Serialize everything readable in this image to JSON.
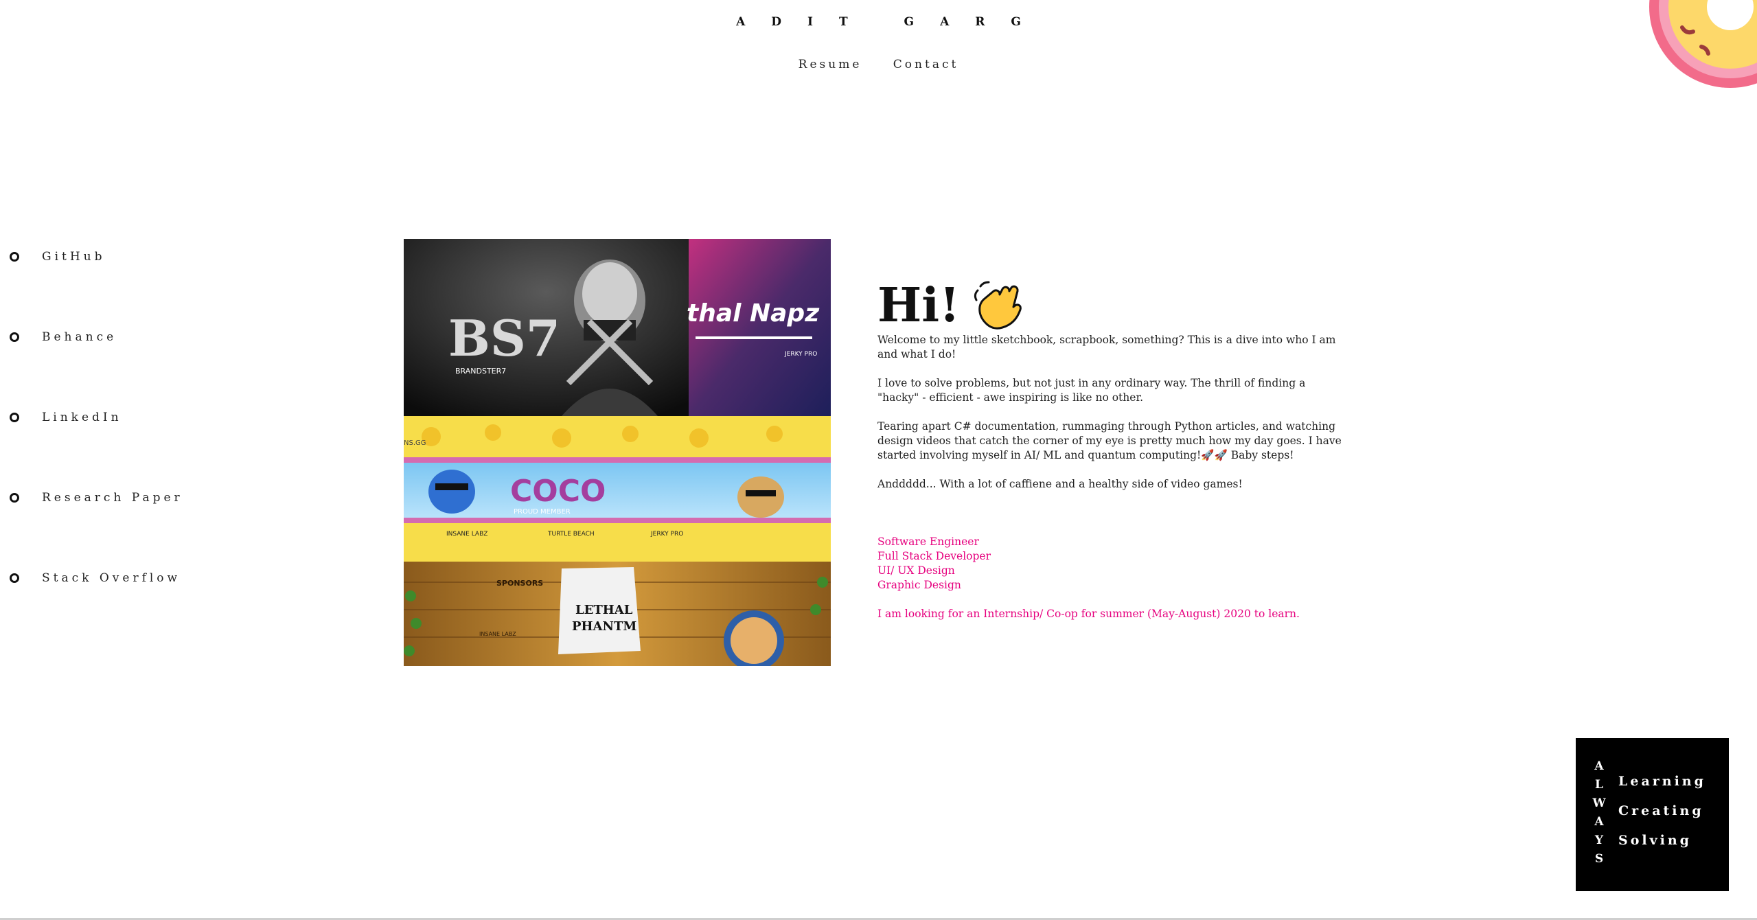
{
  "header": {
    "brand": "ADIT GARG",
    "nav": [
      {
        "label": "Resume"
      },
      {
        "label": "Contact"
      }
    ]
  },
  "sidebar": {
    "items": [
      {
        "label": "GitHub"
      },
      {
        "label": "Behance"
      },
      {
        "label": "LinkedIn"
      },
      {
        "label": "Research Paper"
      },
      {
        "label": "Stack Overflow"
      }
    ]
  },
  "collage": {
    "panel1_text": "BRANDSTER7",
    "panel1_logo": "BS7",
    "panel2_title": "thal Napz",
    "panel2_sponsor": "JERKY PRO",
    "banner_tag": "NS.GG",
    "banner_word": "COCO",
    "banner_member": "PROUD MEMBER",
    "banner_sponsors": [
      "INSANE LABZ",
      "TURTLE BEACH",
      "JERKY PRO"
    ],
    "bottom_sponsors": "SPONSORS",
    "bottom_sub": "INSANE LABZ",
    "bottom_title": [
      "LETHAL",
      "PHANTM"
    ]
  },
  "intro": {
    "greeting": "Hi!",
    "wave_icon": "waving-hand-icon",
    "paragraphs": [
      "Welcome to my little sketchbook, scrapbook, something? This is a dive into who I am and what I do!",
      "I love to solve problems, but not just in any ordinary way. The thrill of finding a \"hacky\" - efficient - awe inspiring is like no other.",
      "Tearing apart C# documentation, rummaging through Python articles, and watching design videos that catch the corner of my eye is pretty much how my day goes. I have started involving myself in AI/ ML and quantum computing!🚀🚀 Baby steps!",
      "Anddddd... With a lot of caffiene and a healthy side of video games!"
    ],
    "roles": [
      "Software Engineer",
      "Full Stack Developer",
      "UI/ UX Design",
      "Graphic Design"
    ],
    "seeking": "I am looking for an Internship/ Co-op for summer (May-August) 2020 to learn."
  },
  "always_box": {
    "vertical": [
      "A",
      "L",
      "W",
      "A",
      "Y",
      "S"
    ],
    "items": [
      "Learning",
      "Creating",
      "Solving"
    ]
  },
  "colors": {
    "accent": "#e6007e",
    "text": "#111111",
    "box": "#000000"
  }
}
